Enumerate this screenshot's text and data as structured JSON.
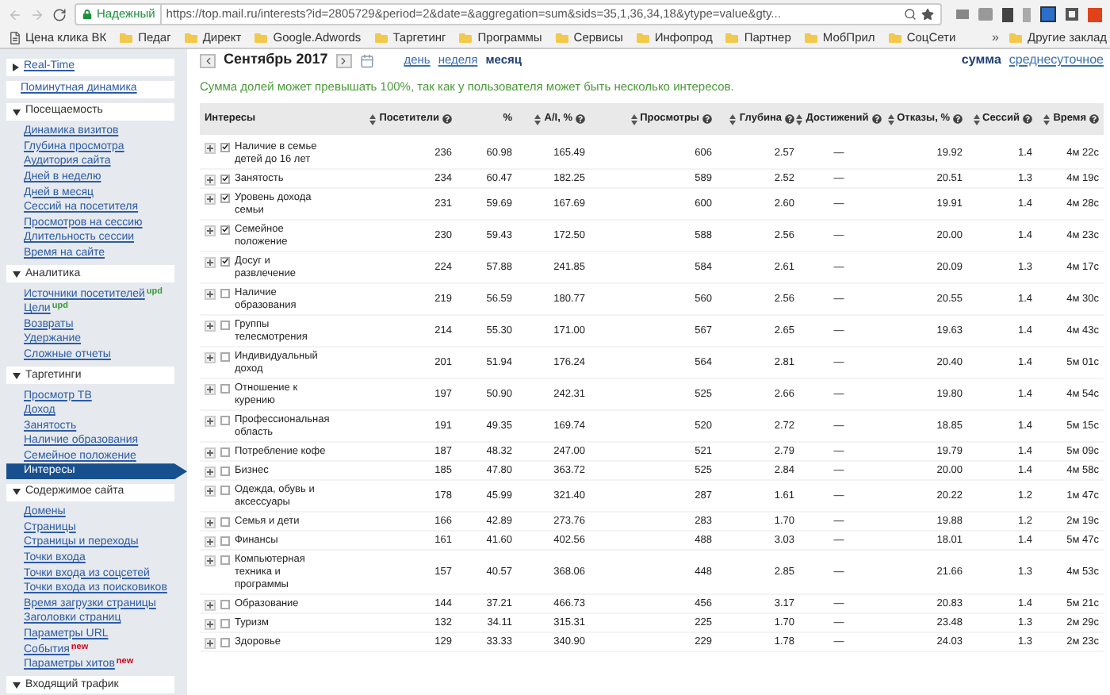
{
  "browser": {
    "security": "Надежный",
    "url": "https://top.mail.ru/interests?id=2805729&period=2&date=&aggregation=sum&sids=35,1,36,34,18&ytype=value&gty...",
    "bookmarks": [
      {
        "label": "Цена клика ВК",
        "kind": "page"
      },
      {
        "label": "Педаг",
        "kind": "folder"
      },
      {
        "label": "Директ",
        "kind": "folder"
      },
      {
        "label": "Google.Adwords",
        "kind": "folder"
      },
      {
        "label": "Таргетинг",
        "kind": "folder"
      },
      {
        "label": "Программы",
        "kind": "folder"
      },
      {
        "label": "Сервисы",
        "kind": "folder"
      },
      {
        "label": "Инфопрод",
        "kind": "folder"
      },
      {
        "label": "Партнер",
        "kind": "folder"
      },
      {
        "label": "МобПрил",
        "kind": "folder"
      },
      {
        "label": "СоцСети",
        "kind": "folder"
      }
    ],
    "more": "»",
    "other_bookmarks": "Другие заклад"
  },
  "sidebar": [
    {
      "title": "Real-Time",
      "kind": "group",
      "expanded": false
    },
    {
      "title": "Поминутная динамика",
      "kind": "link"
    },
    {
      "title": "Посещаемость",
      "kind": "group",
      "expanded": true,
      "items": [
        {
          "label": "Динамика визитов",
          "selected": false
        },
        {
          "label": "Глубина просмотра",
          "selected": false
        },
        {
          "label": "Аудитория сайта",
          "selected": false
        },
        {
          "label": "Дней в неделю",
          "selected": false
        },
        {
          "label": "Дней в месяц",
          "selected": false
        },
        {
          "label": "Сессий на посетителя",
          "selected": false
        },
        {
          "label": "Просмотров на сессию",
          "selected": false
        },
        {
          "label": "Длительность сессии",
          "selected": false
        },
        {
          "label": "Время на сайте",
          "selected": false
        }
      ]
    },
    {
      "title": "Аналитика",
      "kind": "group",
      "expanded": true,
      "items": [
        {
          "label": "Источники посетителей",
          "badge": {
            "text": "upd",
            "color": "#3a9a3a"
          },
          "selected": false
        },
        {
          "label": "Цели",
          "badge": {
            "text": "upd",
            "color": "#3a9a3a"
          },
          "selected": false
        },
        {
          "label": "Возвраты",
          "selected": false
        },
        {
          "label": "Удержание",
          "selected": false
        },
        {
          "label": "Сложные отчеты",
          "selected": false
        }
      ]
    },
    {
      "title": "Таргетинги",
      "kind": "group",
      "expanded": true,
      "items": [
        {
          "label": "Просмотр ТВ",
          "selected": false
        },
        {
          "label": "Доход",
          "selected": false
        },
        {
          "label": "Занятость",
          "selected": false
        },
        {
          "label": "Наличие образования",
          "selected": false
        },
        {
          "label": "Семейное положение",
          "selected": false
        },
        {
          "label": "Интересы",
          "selected": true
        }
      ]
    },
    {
      "title": "Содержимое сайта",
      "kind": "group",
      "expanded": true,
      "items": [
        {
          "label": "Домены",
          "selected": false
        },
        {
          "label": "Страницы",
          "selected": false
        },
        {
          "label": "Страницы и переходы",
          "selected": false
        },
        {
          "label": "Точки входа",
          "selected": false
        },
        {
          "label": "Точки входа из соцсетей",
          "selected": false
        },
        {
          "label": "Точки входа из поисковиков",
          "selected": false
        },
        {
          "label": "Время загрузки страницы",
          "selected": false
        },
        {
          "label": "Заголовки страниц",
          "selected": false
        },
        {
          "label": "Параметры URL",
          "selected": false
        },
        {
          "label": "События",
          "badge": {
            "text": "new",
            "color": "#d0021b"
          },
          "selected": false
        },
        {
          "label": "Параметры хитов",
          "badge": {
            "text": "new",
            "color": "#d0021b"
          },
          "selected": false
        }
      ]
    },
    {
      "title": "Входящий трафик",
      "kind": "group",
      "expanded": true
    }
  ],
  "toolbar": {
    "period": "Сентябрь 2017",
    "ranges": [
      {
        "label": "день",
        "selected": false
      },
      {
        "label": "неделя",
        "selected": false
      },
      {
        "label": "месяц",
        "selected": true
      }
    ],
    "aggregations": [
      {
        "label": "сумма",
        "selected": true
      },
      {
        "label": "среднесуточное",
        "selected": false
      }
    ]
  },
  "note": "Сумма долей может превышать 100%, так как у пользователя может быть несколько интересов.",
  "table": {
    "columns": [
      {
        "label": "Интересы",
        "sortable": false,
        "help": false
      },
      {
        "label": "Посетители",
        "sortable": true,
        "help": true
      },
      {
        "label": "%",
        "sortable": false,
        "help": false
      },
      {
        "label": "A/I, %",
        "sortable": true,
        "help": true
      },
      {
        "label": "Просмотры",
        "sortable": true,
        "help": true
      },
      {
        "label": "Глубина",
        "sortable": true,
        "help": true
      },
      {
        "label": "Достижений",
        "sortable": true,
        "help": true
      },
      {
        "label": "Отказы, %",
        "sortable": true,
        "help": true
      },
      {
        "label": "Сессий",
        "sortable": true,
        "help": true
      },
      {
        "label": "Время",
        "sortable": true,
        "help": true
      }
    ],
    "rows": [
      {
        "checked": true,
        "cells": [
          "Наличие в семье детей до 16 лет",
          "236",
          "60.98",
          "165.49",
          "606",
          "2.57",
          "—",
          "19.92",
          "1.4",
          "4м 22с"
        ]
      },
      {
        "checked": true,
        "cells": [
          "Занятость",
          "234",
          "60.47",
          "182.25",
          "589",
          "2.52",
          "—",
          "20.51",
          "1.3",
          "4м 19с"
        ]
      },
      {
        "checked": true,
        "cells": [
          "Уровень дохода семьи",
          "231",
          "59.69",
          "167.69",
          "600",
          "2.60",
          "—",
          "19.91",
          "1.4",
          "4м 28с"
        ]
      },
      {
        "checked": true,
        "cells": [
          "Семейное положение",
          "230",
          "59.43",
          "172.50",
          "588",
          "2.56",
          "—",
          "20.00",
          "1.4",
          "4м 23с"
        ]
      },
      {
        "checked": true,
        "cells": [
          "Досуг и развлечение",
          "224",
          "57.88",
          "241.85",
          "584",
          "2.61",
          "—",
          "20.09",
          "1.3",
          "4м 17с"
        ]
      },
      {
        "checked": false,
        "cells": [
          "Наличие образования",
          "219",
          "56.59",
          "180.77",
          "560",
          "2.56",
          "—",
          "20.55",
          "1.4",
          "4м 30с"
        ]
      },
      {
        "checked": false,
        "cells": [
          "Группы телесмотрения",
          "214",
          "55.30",
          "171.00",
          "567",
          "2.65",
          "—",
          "19.63",
          "1.4",
          "4м 43с"
        ]
      },
      {
        "checked": false,
        "cells": [
          "Индивидуальный доход",
          "201",
          "51.94",
          "176.24",
          "564",
          "2.81",
          "—",
          "20.40",
          "1.4",
          "5м 01с"
        ]
      },
      {
        "checked": false,
        "cells": [
          "Отношение к курению",
          "197",
          "50.90",
          "242.31",
          "525",
          "2.66",
          "—",
          "19.80",
          "1.4",
          "4м 54с"
        ]
      },
      {
        "checked": false,
        "cells": [
          "Профессиональная область",
          "191",
          "49.35",
          "169.74",
          "520",
          "2.72",
          "—",
          "18.85",
          "1.4",
          "5м 15с"
        ]
      },
      {
        "checked": false,
        "cells": [
          "Потребление кофе",
          "187",
          "48.32",
          "247.00",
          "521",
          "2.79",
          "—",
          "19.79",
          "1.4",
          "5м 09с"
        ]
      },
      {
        "checked": false,
        "cells": [
          "Бизнес",
          "185",
          "47.80",
          "363.72",
          "525",
          "2.84",
          "—",
          "20.00",
          "1.4",
          "4м 58с"
        ]
      },
      {
        "checked": false,
        "cells": [
          "Одежда, обувь и аксессуары",
          "178",
          "45.99",
          "321.40",
          "287",
          "1.61",
          "—",
          "20.22",
          "1.2",
          "1м 47с"
        ]
      },
      {
        "checked": false,
        "cells": [
          "Семья и дети",
          "166",
          "42.89",
          "273.76",
          "283",
          "1.70",
          "—",
          "19.88",
          "1.2",
          "2м 19с"
        ]
      },
      {
        "checked": false,
        "cells": [
          "Финансы",
          "161",
          "41.60",
          "402.56",
          "488",
          "3.03",
          "—",
          "18.01",
          "1.4",
          "5м 47с"
        ]
      },
      {
        "checked": false,
        "cells": [
          "Компьютерная техника и программы",
          "157",
          "40.57",
          "368.06",
          "448",
          "2.85",
          "—",
          "21.66",
          "1.3",
          "4м 53с"
        ]
      },
      {
        "checked": false,
        "cells": [
          "Образование",
          "144",
          "37.21",
          "466.73",
          "456",
          "3.17",
          "—",
          "20.83",
          "1.4",
          "5м 21с"
        ]
      },
      {
        "checked": false,
        "cells": [
          "Туризм",
          "132",
          "34.11",
          "315.31",
          "225",
          "1.70",
          "—",
          "23.48",
          "1.3",
          "2м 29с"
        ]
      },
      {
        "checked": false,
        "cells": [
          "Здоровье",
          "129",
          "33.33",
          "340.90",
          "229",
          "1.78",
          "—",
          "24.03",
          "1.3",
          "2м 23с"
        ]
      }
    ]
  }
}
